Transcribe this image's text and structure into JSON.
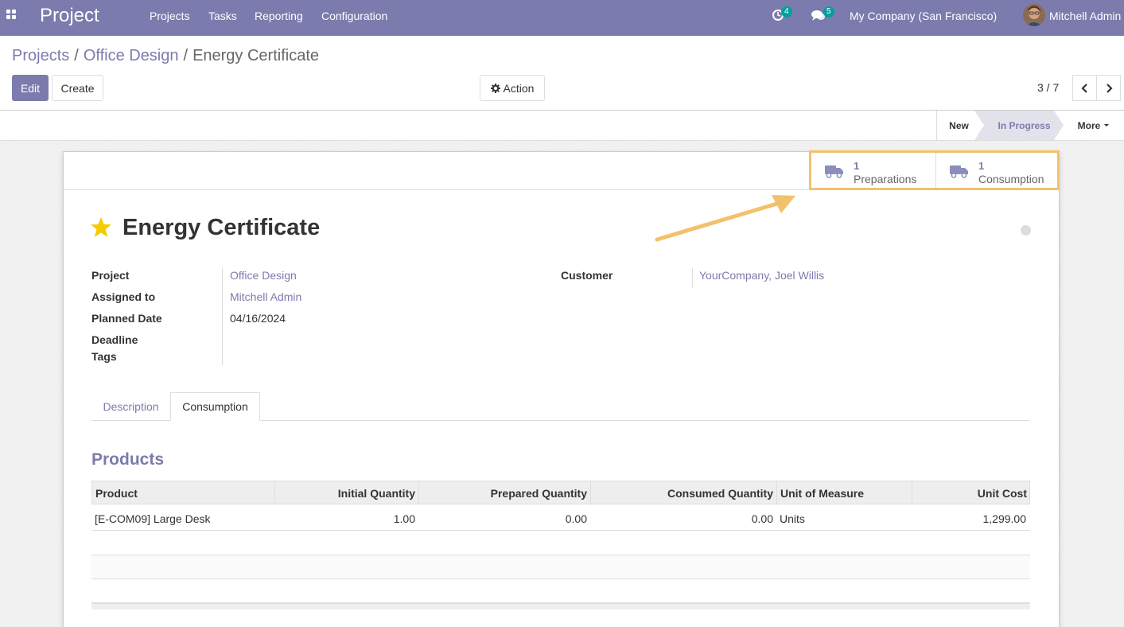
{
  "navbar": {
    "app_name": "Project",
    "menus": [
      "Projects",
      "Tasks",
      "Reporting",
      "Configuration"
    ],
    "activity_badge": "4",
    "messages_badge": "5",
    "company": "My Company (San Francisco)",
    "user": "Mitchell Admin"
  },
  "breadcrumb": {
    "items": [
      "Projects",
      "Office Design"
    ],
    "current": "Energy Certificate",
    "separator": "/"
  },
  "toolbar": {
    "edit_label": "Edit",
    "create_label": "Create",
    "action_label": "Action",
    "pager": "3 / 7"
  },
  "statusbar": {
    "stages": [
      "New",
      "In Progress"
    ],
    "active_stage": "In Progress",
    "more_label": "More"
  },
  "smart_buttons": [
    {
      "value": "1",
      "label": "Preparations",
      "icon": "truck-icon"
    },
    {
      "value": "1",
      "label": "Consumption",
      "icon": "truck-icon"
    }
  ],
  "task": {
    "title": "Energy Certificate",
    "starred": true
  },
  "fields": {
    "project_label": "Project",
    "project_value": "Office Design",
    "assigned_label": "Assigned to",
    "assigned_value": "Mitchell Admin",
    "planned_label": "Planned Date",
    "planned_value": "04/16/2024",
    "deadline_label": "Deadline",
    "tags_label": "Tags",
    "customer_label": "Customer",
    "customer_value": "YourCompany, Joel Willis"
  },
  "tabs": [
    "Description",
    "Consumption"
  ],
  "active_tab": "Consumption",
  "products": {
    "section_title": "Products",
    "columns": [
      "Product",
      "Initial Quantity",
      "Prepared Quantity",
      "Consumed Quantity",
      "Unit of Measure",
      "Unit Cost"
    ],
    "rows": [
      [
        "[E-COM09] Large Desk",
        "1.00",
        "0.00",
        "0.00",
        "Units",
        "1,299.00"
      ]
    ]
  },
  "colors": {
    "brand": "#7c7bad",
    "badge": "#00a09d",
    "highlight": "#f3c16b",
    "star": "#f3cc00"
  }
}
